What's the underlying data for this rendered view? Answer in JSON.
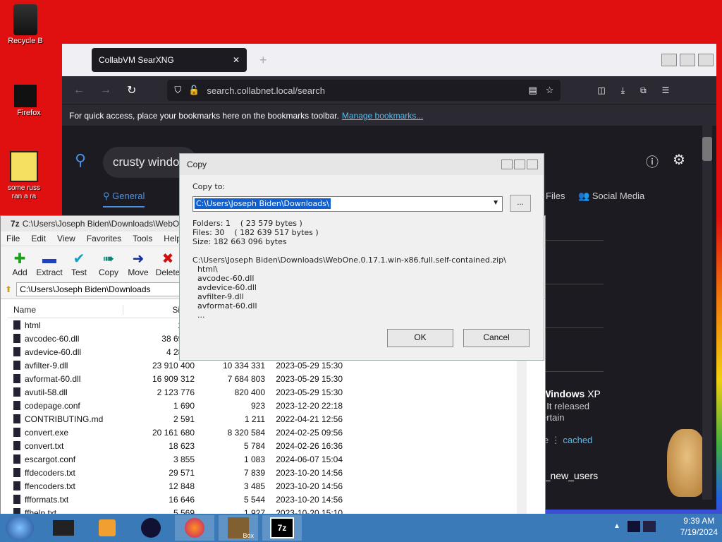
{
  "desktop": {
    "icons": [
      {
        "label": "Recycle B"
      },
      {
        "label": "Firefox"
      },
      {
        "label": "some russ\nran a ra"
      }
    ]
  },
  "sevenzip": {
    "title": "C:\\Users\\Joseph Biden\\Downloads\\WebO",
    "menu": [
      "File",
      "Edit",
      "View",
      "Favorites",
      "Tools",
      "Help"
    ],
    "toolbar": [
      "Add",
      "Extract",
      "Test",
      "Copy",
      "Move",
      "Delete"
    ],
    "address": "C:\\Users\\Joseph Biden\\Downloads",
    "columns": {
      "name": "Name",
      "size": "Si"
    },
    "rows": [
      {
        "name": "html",
        "size": "23 5",
        "packed": "",
        "modified": ""
      },
      {
        "name": "avcodec-60.dll",
        "size": "38 691 8",
        "packed": "",
        "modified": ""
      },
      {
        "name": "avdevice-60.dll",
        "size": "4 281 3",
        "packed": "",
        "modified": ""
      },
      {
        "name": "avfilter-9.dll",
        "size": "23 910 400",
        "packed": "10 334 331",
        "modified": "2023-05-29 15:30"
      },
      {
        "name": "avformat-60.dll",
        "size": "16 909 312",
        "packed": "7 684 803",
        "modified": "2023-05-29 15:30"
      },
      {
        "name": "avutil-58.dll",
        "size": "2 123 776",
        "packed": "820 400",
        "modified": "2023-05-29 15:30"
      },
      {
        "name": "codepage.conf",
        "size": "1 690",
        "packed": "923",
        "modified": "2023-12-20 22:18"
      },
      {
        "name": "CONTRIBUTING.md",
        "size": "2 591",
        "packed": "1 211",
        "modified": "2022-04-21 12:56"
      },
      {
        "name": "convert.exe",
        "size": "20 161 680",
        "packed": "8 320 584",
        "modified": "2024-02-25 09:56"
      },
      {
        "name": "convert.txt",
        "size": "18 623",
        "packed": "5 784",
        "modified": "2024-02-26 16:36"
      },
      {
        "name": "escargot.conf",
        "size": "3 855",
        "packed": "1 083",
        "modified": "2024-06-07 15:04"
      },
      {
        "name": "ffdecoders.txt",
        "size": "29 571",
        "packed": "7 839",
        "modified": "2023-10-20 14:56"
      },
      {
        "name": "ffencoders.txt",
        "size": "12 848",
        "packed": "3 485",
        "modified": "2023-10-20 14:56"
      },
      {
        "name": "ffformats.txt",
        "size": "16 646",
        "packed": "5 544",
        "modified": "2023-10-20 14:56"
      },
      {
        "name": "ffhelp.txt",
        "size": "5 569",
        "packed": "1 927",
        "modified": "2023-10-20 15:10"
      }
    ]
  },
  "browser": {
    "tab_title": "CollabVM SearXNG",
    "url": "search.collabnet.local/search",
    "bookmarks_text": "For quick access, place your bookmarks here on the bookmarks toolbar.",
    "bookmarks_link": "Manage bookmarks...",
    "query": "crusty windo",
    "tabs": {
      "general": "General",
      "files": "Files",
      "social": "Social Media"
    },
    "result": {
      "title_a": "Windows",
      "title_b": "XP",
      "line1": ". It released",
      "line2": "ertain",
      "meta": "le",
      "cached": "cached",
      "bottom": "r_new_users"
    }
  },
  "dialog": {
    "title": "Copy",
    "copy_to_label": "Copy to:",
    "path": "C:\\Users\\Joseph Biden\\Downloads\\",
    "browse": "...",
    "stats": "Folders: 1    ( 23 579 bytes )\nFiles: 30    ( 182 639 517 bytes )\nSize: 182 663 096 bytes",
    "source": "C:\\Users\\Joseph Biden\\Downloads\\WebOne.0.17.1.win-x86.full.self-contained.zip\\\n  html\\\n  avcodec-60.dll\n  avdevice-60.dll\n  avfilter-9.dll\n  avformat-60.dll\n  ...",
    "ok": "OK",
    "cancel": "Cancel"
  },
  "taskbar": {
    "time": "9:39 AM",
    "date": "7/19/2024",
    "box_label": "Box",
    "sevenzip_label": "7z"
  },
  "colors": {
    "accent": "#1060d0",
    "link": "#5abbe8",
    "taskbar": "#3a7ab8"
  }
}
